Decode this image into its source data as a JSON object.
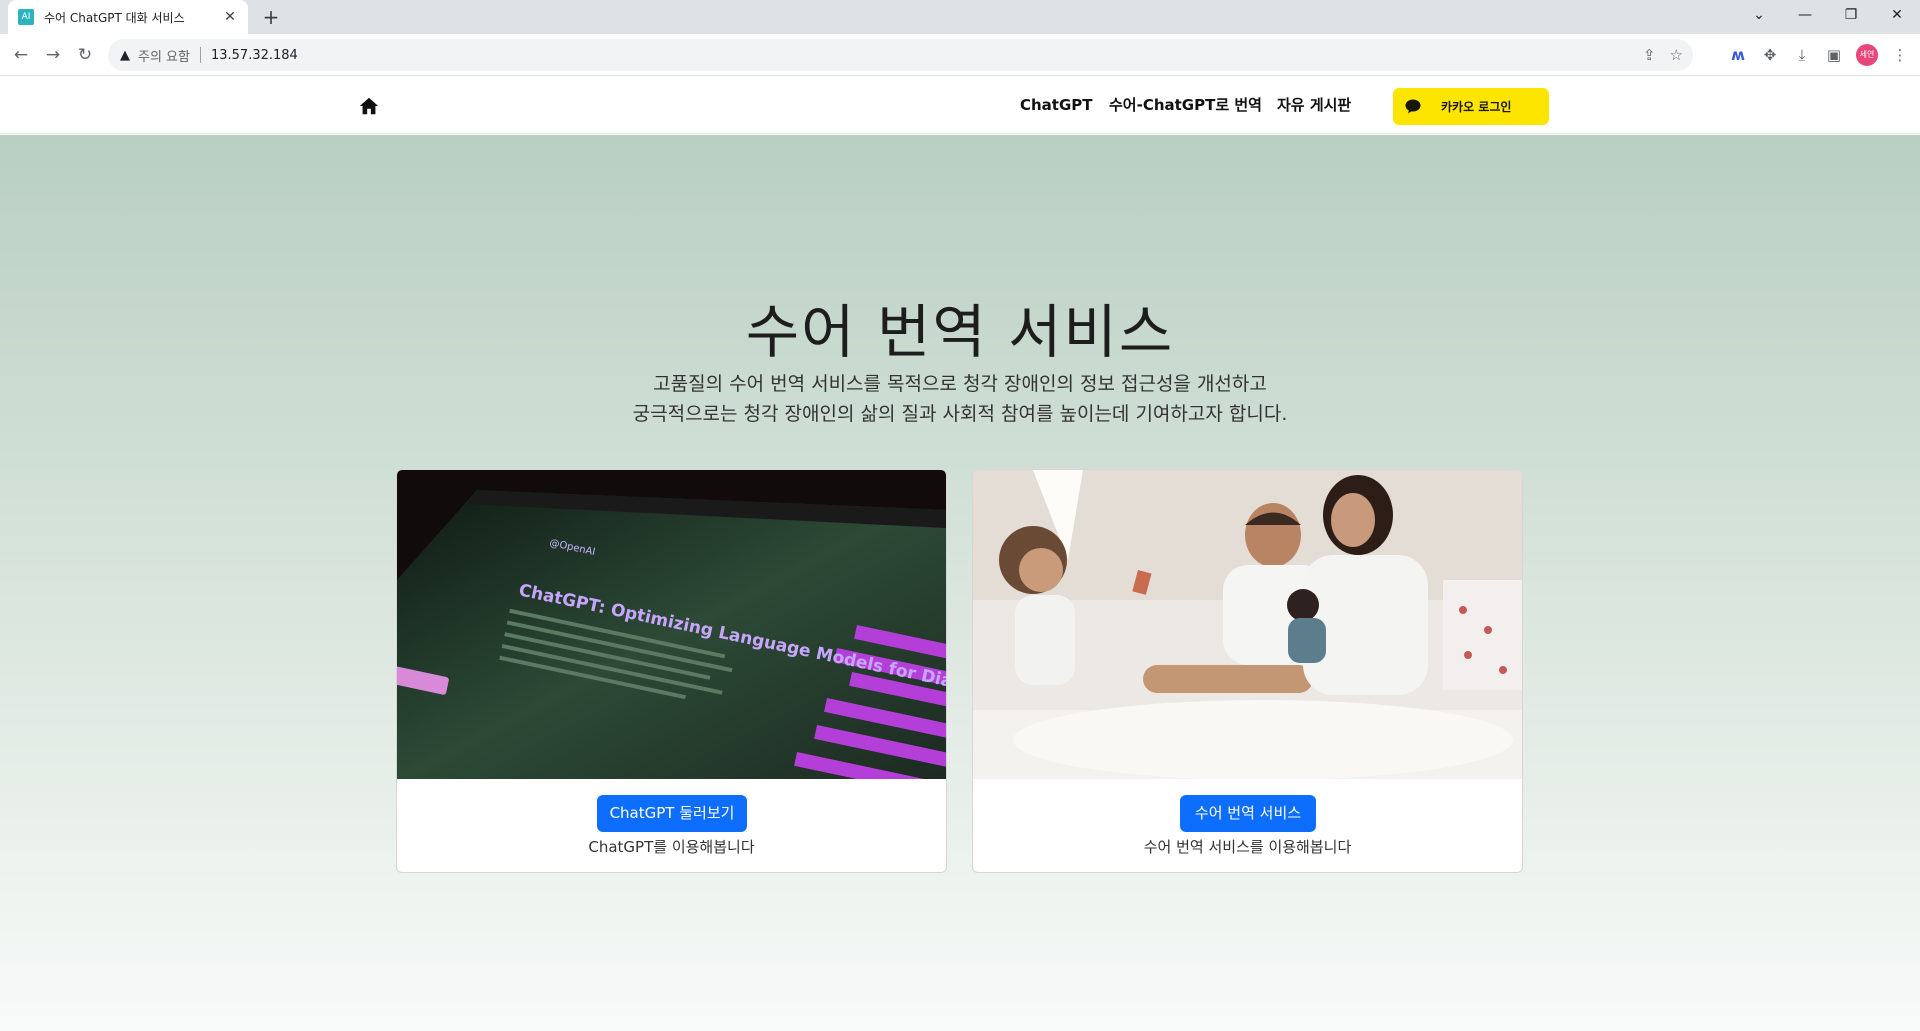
{
  "browser": {
    "tab_title": "수어 ChatGPT 대화 서비스",
    "tab_favicon_label": "AI",
    "address_warning": "주의 요함",
    "address_url": "13.57.32.184",
    "profile_label": "세연"
  },
  "navbar": {
    "links": [
      "ChatGPT",
      "수어-ChatGPT로 번역",
      "자유 게시판"
    ],
    "kakao_login": "카카오 로그인"
  },
  "hero": {
    "title": "수어 번역 서비스",
    "subtitle_line1": "고품질의 수어 번역 서비스를 목적으로 청각 장애인의 정보 접근성을 개선하고",
    "subtitle_line2": "궁극적으로는 청각 장애인의 삶의 질과 사회적 참여를 높이는데 기여하고자 합니다."
  },
  "cards": [
    {
      "image_title": "ChatGPT: Optimizing Language Models for Dialogue",
      "image_brand": "@OpenAI",
      "button": "ChatGPT 둘러보기",
      "text": "ChatGPT를 이용해봅니다"
    },
    {
      "button": "수어 번역 서비스",
      "text": "수어 번역 서비스를 이용해봅니다"
    }
  ],
  "colors": {
    "primary": "#0d6efd",
    "kakao": "#fee500"
  }
}
